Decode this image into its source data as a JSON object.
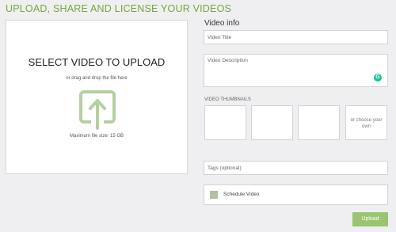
{
  "page_title": "UPLOAD, SHARE AND LICENSE YOUR VIDEOS",
  "upload_panel": {
    "heading": "SELECT VIDEO TO UPLOAD",
    "subtext": "or drag and drop the file here",
    "max_size": "Maximum file size: 15 GB",
    "icon": "upload-arrow-icon"
  },
  "video_info": {
    "title": "Video info",
    "title_placeholder": "Video Title",
    "description_placeholder": "Video Description",
    "grammarly_icon": "grammarly-icon"
  },
  "thumbnails": {
    "label": "VIDEO THUMBNAILS",
    "choose_own": "or choose your own"
  },
  "tags": {
    "placeholder": "Tags (optional)"
  },
  "schedule": {
    "label": "Schedule Video",
    "checked": false
  },
  "actions": {
    "upload_label": "Upload"
  },
  "colors": {
    "accent": "#74a63f",
    "button": "#9bc471",
    "icon": "#b6cfa0"
  }
}
